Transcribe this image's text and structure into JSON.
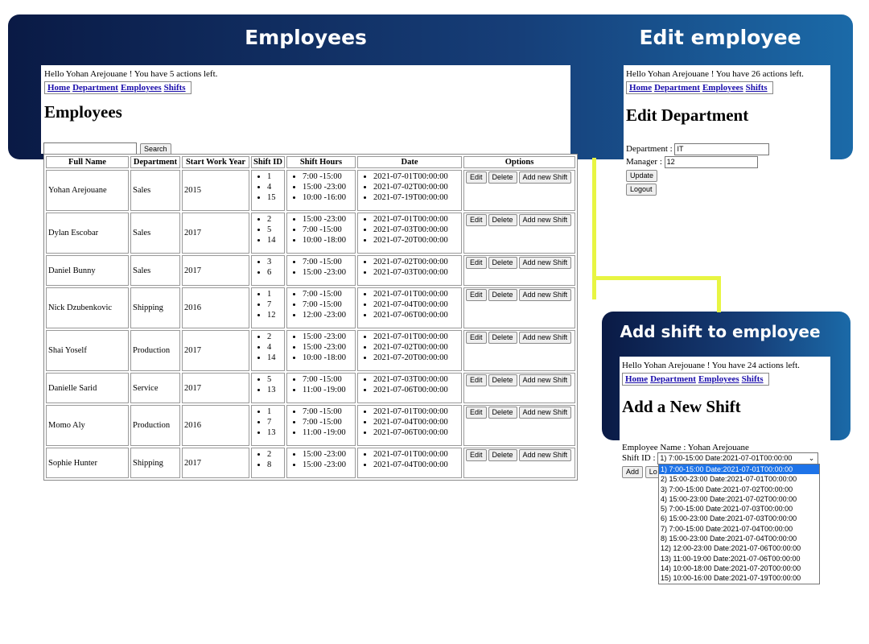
{
  "banners": {
    "employees": "Employees",
    "edit": "Edit employee",
    "add_shift": "Add shift to employee"
  },
  "employees_page": {
    "greeting": "Hello Yohan Arejouane ! You have 5 actions left.",
    "nav": [
      "Home",
      "Department",
      "Employees",
      "Shifts"
    ],
    "title": "Employees",
    "search_button": "Search",
    "search_value": "",
    "columns": [
      "Full Name",
      "Department",
      "Start Work Year",
      "Shift ID",
      "Shift Hours",
      "Date",
      "Options"
    ],
    "row_buttons": [
      "Edit",
      "Delete",
      "Add new Shift"
    ],
    "rows": [
      {
        "name": "Yohan Arejouane",
        "department": "Sales",
        "year": "2015",
        "ids": [
          "1",
          "4",
          "15"
        ],
        "hours": [
          "7:00 -15:00",
          "15:00 -23:00",
          "10:00 -16:00"
        ],
        "dates": [
          "2021-07-01T00:00:00",
          "2021-07-02T00:00:00",
          "2021-07-19T00:00:00"
        ]
      },
      {
        "name": "Dylan Escobar",
        "department": "Sales",
        "year": "2017",
        "ids": [
          "2",
          "5",
          "14"
        ],
        "hours": [
          "15:00 -23:00",
          "7:00 -15:00",
          "10:00 -18:00"
        ],
        "dates": [
          "2021-07-01T00:00:00",
          "2021-07-03T00:00:00",
          "2021-07-20T00:00:00"
        ]
      },
      {
        "name": "Daniel Bunny",
        "department": "Sales",
        "year": "2017",
        "ids": [
          "3",
          "6"
        ],
        "hours": [
          "7:00 -15:00",
          "15:00 -23:00"
        ],
        "dates": [
          "2021-07-02T00:00:00",
          "2021-07-03T00:00:00"
        ]
      },
      {
        "name": "Nick Dzubenkovic",
        "department": "Shipping",
        "year": "2016",
        "ids": [
          "1",
          "7",
          "12"
        ],
        "hours": [
          "7:00 -15:00",
          "7:00 -15:00",
          "12:00 -23:00"
        ],
        "dates": [
          "2021-07-01T00:00:00",
          "2021-07-04T00:00:00",
          "2021-07-06T00:00:00"
        ]
      },
      {
        "name": "Shai Yoself",
        "department": "Production",
        "year": "2017",
        "ids": [
          "2",
          "4",
          "14"
        ],
        "hours": [
          "15:00 -23:00",
          "15:00 -23:00",
          "10:00 -18:00"
        ],
        "dates": [
          "2021-07-01T00:00:00",
          "2021-07-02T00:00:00",
          "2021-07-20T00:00:00"
        ]
      },
      {
        "name": "Danielle Sarid",
        "department": "Service",
        "year": "2017",
        "ids": [
          "5",
          "13"
        ],
        "hours": [
          "7:00 -15:00",
          "11:00 -19:00"
        ],
        "dates": [
          "2021-07-03T00:00:00",
          "2021-07-06T00:00:00"
        ]
      },
      {
        "name": "Momo Aly",
        "department": "Production",
        "year": "2016",
        "ids": [
          "1",
          "7",
          "13"
        ],
        "hours": [
          "7:00 -15:00",
          "7:00 -15:00",
          "11:00 -19:00"
        ],
        "dates": [
          "2021-07-01T00:00:00",
          "2021-07-04T00:00:00",
          "2021-07-06T00:00:00"
        ]
      },
      {
        "name": "Sophie Hunter",
        "department": "Shipping",
        "year": "2017",
        "ids": [
          "2",
          "8"
        ],
        "hours": [
          "15:00 -23:00",
          "15:00 -23:00"
        ],
        "dates": [
          "2021-07-01T00:00:00",
          "2021-07-04T00:00:00"
        ]
      }
    ]
  },
  "edit_page": {
    "greeting": "Hello Yohan Arejouane ! You have 26 actions left.",
    "nav": [
      "Home",
      "Department",
      "Employees",
      "Shifts"
    ],
    "title": "Edit Department",
    "department_label": "Department :",
    "department_value": "IT",
    "manager_label": "Manager :",
    "manager_value": "12",
    "update_button": "Update",
    "logout_button": "Logout"
  },
  "add_shift_page": {
    "greeting": "Hello Yohan Arejouane ! You have 24 actions left.",
    "nav": [
      "Home",
      "Department",
      "Employees",
      "Shifts"
    ],
    "title": "Add a New Shift",
    "employee_label": "Employee Name : Yohan Arejouane",
    "shift_label": "Shift ID :",
    "shift_selected": "1) 7:00-15:00 Date:2021-07-01T00:00:00",
    "add_button": "Add",
    "logout_button_visible": "Lo",
    "options": [
      "1) 7:00-15:00 Date:2021-07-01T00:00:00",
      "2) 15:00-23:00 Date:2021-07-01T00:00:00",
      "3) 7:00-15:00 Date:2021-07-02T00:00:00",
      "4) 15:00-23:00 Date:2021-07-02T00:00:00",
      "5) 7:00-15:00 Date:2021-07-03T00:00:00",
      "6) 15:00-23:00 Date:2021-07-03T00:00:00",
      "7) 7:00-15:00 Date:2021-07-04T00:00:00",
      "8) 15:00-23:00 Date:2021-07-04T00:00:00",
      "12) 12:00-23:00 Date:2021-07-06T00:00:00",
      "13) 11:00-19:00 Date:2021-07-06T00:00:00",
      "14) 10:00-18:00 Date:2021-07-20T00:00:00",
      "15) 10:00-16:00 Date:2021-07-19T00:00:00"
    ],
    "highlighted_option_index": 0
  },
  "colors": {
    "banner_dark": "#0a1a45",
    "banner_light": "#1b6aa8",
    "connector": "#e8f542",
    "link": "#1a0dab",
    "dropdown_highlight": "#1e73e8"
  }
}
